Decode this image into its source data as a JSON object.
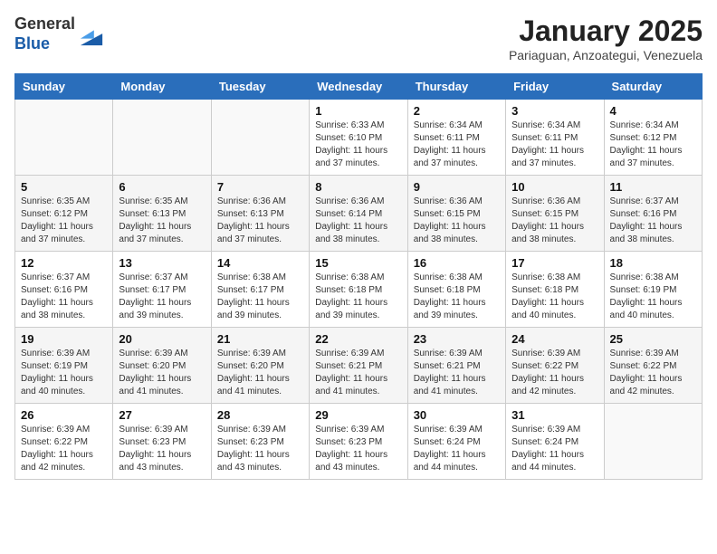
{
  "header": {
    "logo_general": "General",
    "logo_blue": "Blue",
    "month_title": "January 2025",
    "location": "Pariaguan, Anzoategui, Venezuela"
  },
  "weekdays": [
    "Sunday",
    "Monday",
    "Tuesday",
    "Wednesday",
    "Thursday",
    "Friday",
    "Saturday"
  ],
  "weeks": [
    [
      {
        "day": "",
        "info": ""
      },
      {
        "day": "",
        "info": ""
      },
      {
        "day": "",
        "info": ""
      },
      {
        "day": "1",
        "info": "Sunrise: 6:33 AM\nSunset: 6:10 PM\nDaylight: 11 hours and 37 minutes."
      },
      {
        "day": "2",
        "info": "Sunrise: 6:34 AM\nSunset: 6:11 PM\nDaylight: 11 hours and 37 minutes."
      },
      {
        "day": "3",
        "info": "Sunrise: 6:34 AM\nSunset: 6:11 PM\nDaylight: 11 hours and 37 minutes."
      },
      {
        "day": "4",
        "info": "Sunrise: 6:34 AM\nSunset: 6:12 PM\nDaylight: 11 hours and 37 minutes."
      }
    ],
    [
      {
        "day": "5",
        "info": "Sunrise: 6:35 AM\nSunset: 6:12 PM\nDaylight: 11 hours and 37 minutes."
      },
      {
        "day": "6",
        "info": "Sunrise: 6:35 AM\nSunset: 6:13 PM\nDaylight: 11 hours and 37 minutes."
      },
      {
        "day": "7",
        "info": "Sunrise: 6:36 AM\nSunset: 6:13 PM\nDaylight: 11 hours and 37 minutes."
      },
      {
        "day": "8",
        "info": "Sunrise: 6:36 AM\nSunset: 6:14 PM\nDaylight: 11 hours and 38 minutes."
      },
      {
        "day": "9",
        "info": "Sunrise: 6:36 AM\nSunset: 6:15 PM\nDaylight: 11 hours and 38 minutes."
      },
      {
        "day": "10",
        "info": "Sunrise: 6:36 AM\nSunset: 6:15 PM\nDaylight: 11 hours and 38 minutes."
      },
      {
        "day": "11",
        "info": "Sunrise: 6:37 AM\nSunset: 6:16 PM\nDaylight: 11 hours and 38 minutes."
      }
    ],
    [
      {
        "day": "12",
        "info": "Sunrise: 6:37 AM\nSunset: 6:16 PM\nDaylight: 11 hours and 38 minutes."
      },
      {
        "day": "13",
        "info": "Sunrise: 6:37 AM\nSunset: 6:17 PM\nDaylight: 11 hours and 39 minutes."
      },
      {
        "day": "14",
        "info": "Sunrise: 6:38 AM\nSunset: 6:17 PM\nDaylight: 11 hours and 39 minutes."
      },
      {
        "day": "15",
        "info": "Sunrise: 6:38 AM\nSunset: 6:18 PM\nDaylight: 11 hours and 39 minutes."
      },
      {
        "day": "16",
        "info": "Sunrise: 6:38 AM\nSunset: 6:18 PM\nDaylight: 11 hours and 39 minutes."
      },
      {
        "day": "17",
        "info": "Sunrise: 6:38 AM\nSunset: 6:18 PM\nDaylight: 11 hours and 40 minutes."
      },
      {
        "day": "18",
        "info": "Sunrise: 6:38 AM\nSunset: 6:19 PM\nDaylight: 11 hours and 40 minutes."
      }
    ],
    [
      {
        "day": "19",
        "info": "Sunrise: 6:39 AM\nSunset: 6:19 PM\nDaylight: 11 hours and 40 minutes."
      },
      {
        "day": "20",
        "info": "Sunrise: 6:39 AM\nSunset: 6:20 PM\nDaylight: 11 hours and 41 minutes."
      },
      {
        "day": "21",
        "info": "Sunrise: 6:39 AM\nSunset: 6:20 PM\nDaylight: 11 hours and 41 minutes."
      },
      {
        "day": "22",
        "info": "Sunrise: 6:39 AM\nSunset: 6:21 PM\nDaylight: 11 hours and 41 minutes."
      },
      {
        "day": "23",
        "info": "Sunrise: 6:39 AM\nSunset: 6:21 PM\nDaylight: 11 hours and 41 minutes."
      },
      {
        "day": "24",
        "info": "Sunrise: 6:39 AM\nSunset: 6:22 PM\nDaylight: 11 hours and 42 minutes."
      },
      {
        "day": "25",
        "info": "Sunrise: 6:39 AM\nSunset: 6:22 PM\nDaylight: 11 hours and 42 minutes."
      }
    ],
    [
      {
        "day": "26",
        "info": "Sunrise: 6:39 AM\nSunset: 6:22 PM\nDaylight: 11 hours and 42 minutes."
      },
      {
        "day": "27",
        "info": "Sunrise: 6:39 AM\nSunset: 6:23 PM\nDaylight: 11 hours and 43 minutes."
      },
      {
        "day": "28",
        "info": "Sunrise: 6:39 AM\nSunset: 6:23 PM\nDaylight: 11 hours and 43 minutes."
      },
      {
        "day": "29",
        "info": "Sunrise: 6:39 AM\nSunset: 6:23 PM\nDaylight: 11 hours and 43 minutes."
      },
      {
        "day": "30",
        "info": "Sunrise: 6:39 AM\nSunset: 6:24 PM\nDaylight: 11 hours and 44 minutes."
      },
      {
        "day": "31",
        "info": "Sunrise: 6:39 AM\nSunset: 6:24 PM\nDaylight: 11 hours and 44 minutes."
      },
      {
        "day": "",
        "info": ""
      }
    ]
  ]
}
